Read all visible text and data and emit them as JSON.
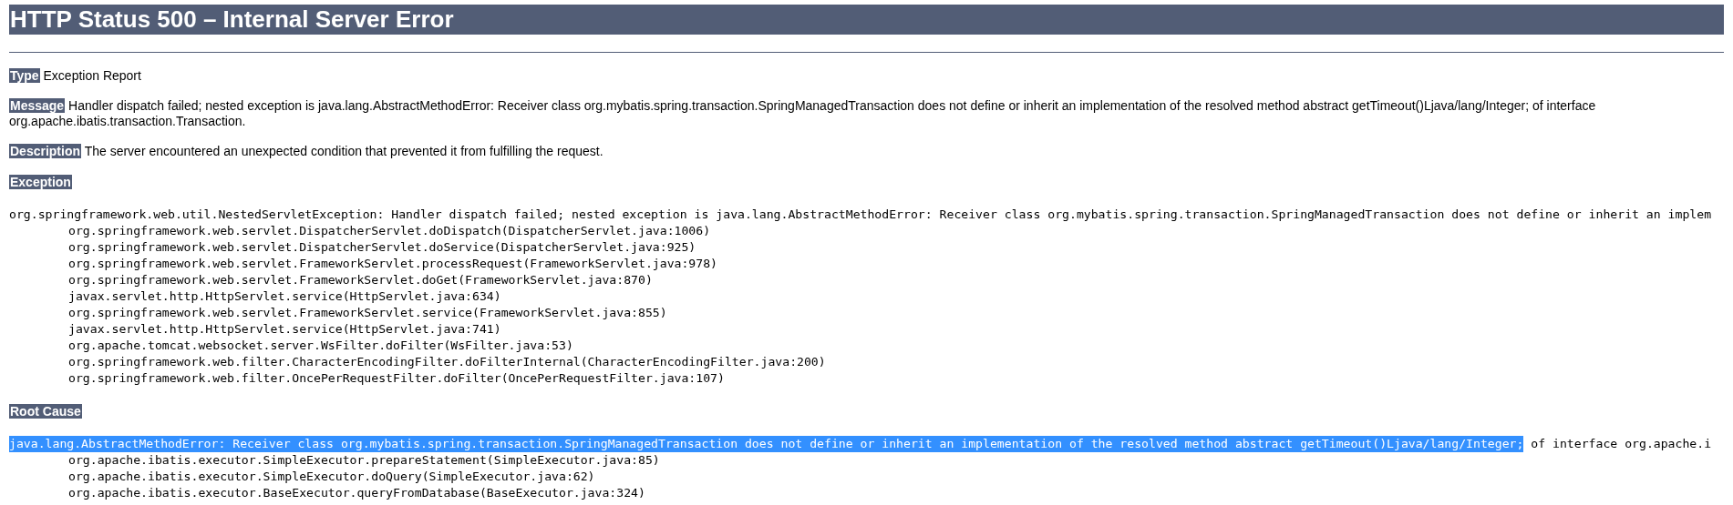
{
  "title": "HTTP Status 500 – Internal Server Error",
  "fields": [
    {
      "label": "Type",
      "text": "Exception Report"
    },
    {
      "label": "Message",
      "text": "Handler dispatch failed; nested exception is java.lang.AbstractMethodError: Receiver class org.mybatis.spring.transaction.SpringManagedTransaction does not define or inherit an implementation of the resolved method abstract getTimeout()Ljava/lang/Integer; of interface org.apache.ibatis.transaction.Transaction."
    },
    {
      "label": "Description",
      "text": "The server encountered an unexpected condition that prevented it from fulfilling the request."
    }
  ],
  "exception": {
    "heading": "Exception",
    "first_line": [
      {
        "text": "org.springframework.web.util.NestedServletException: Handler dispatch failed; nested exception is java.lang.AbstractMethodError: Receiver class org.mybatis.spring.transaction.SpringManagedTransaction does not define or inherit an implem",
        "selected": false
      }
    ],
    "frames": [
      "org.springframework.web.servlet.DispatcherServlet.doDispatch(DispatcherServlet.java:1006)",
      "org.springframework.web.servlet.DispatcherServlet.doService(DispatcherServlet.java:925)",
      "org.springframework.web.servlet.FrameworkServlet.processRequest(FrameworkServlet.java:978)",
      "org.springframework.web.servlet.FrameworkServlet.doGet(FrameworkServlet.java:870)",
      "javax.servlet.http.HttpServlet.service(HttpServlet.java:634)",
      "org.springframework.web.servlet.FrameworkServlet.service(FrameworkServlet.java:855)",
      "javax.servlet.http.HttpServlet.service(HttpServlet.java:741)",
      "org.apache.tomcat.websocket.server.WsFilter.doFilter(WsFilter.java:53)",
      "org.springframework.web.filter.CharacterEncodingFilter.doFilterInternal(CharacterEncodingFilter.java:200)",
      "org.springframework.web.filter.OncePerRequestFilter.doFilter(OncePerRequestFilter.java:107)"
    ]
  },
  "root_cause": {
    "heading": "Root Cause",
    "first_line": [
      {
        "text": "java.lang.AbstractMethodError: Receiver class org.mybatis.spring.transaction.SpringManagedTransaction does not define or inherit an implementation of the resolved method abstract getTimeout()Ljava/lang/Integer;",
        "selected": true
      },
      {
        "text": " of interface org.apache.i",
        "selected": false
      }
    ],
    "frames": [
      "org.apache.ibatis.executor.SimpleExecutor.prepareStatement(SimpleExecutor.java:85)",
      "org.apache.ibatis.executor.SimpleExecutor.doQuery(SimpleExecutor.java:62)",
      "org.apache.ibatis.executor.BaseExecutor.queryFromDatabase(BaseExecutor.java:324)"
    ]
  }
}
